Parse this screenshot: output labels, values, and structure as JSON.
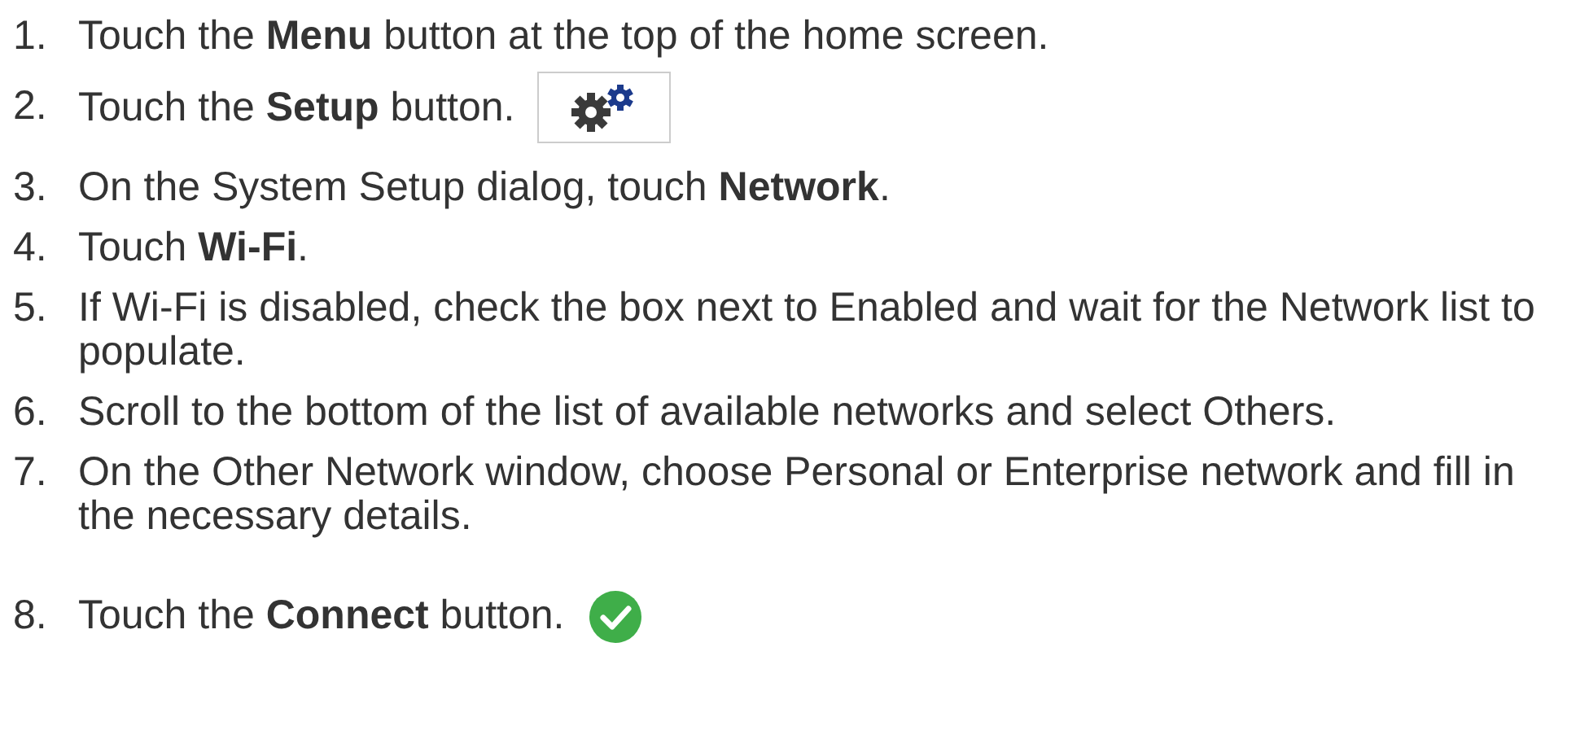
{
  "steps": [
    {
      "number": "1.",
      "text": "Touch the **Menu** button at the top of the home screen."
    },
    {
      "number": "2.",
      "text": "Touch the **Setup** button.",
      "kind": "gears"
    },
    {
      "number": "3.",
      "text": "On the System Setup dialog, touch **Network**."
    },
    {
      "number": "4.",
      "text": "Touch **Wi-Fi**."
    },
    {
      "number": "5.",
      "text": "If Wi-Fi is disabled, check the box next to Enabled and wait for the Network list to populate."
    },
    {
      "number": "6.",
      "text": "Scroll to the bottom of the list of available networks and select Others."
    },
    {
      "number": "7.",
      "text": "On the Other Network window, choose Personal or Enterprise network and fill in the necessary details."
    },
    {
      "number": "8.",
      "text": "Touch the **Connect** button.",
      "kind": "check"
    }
  ]
}
